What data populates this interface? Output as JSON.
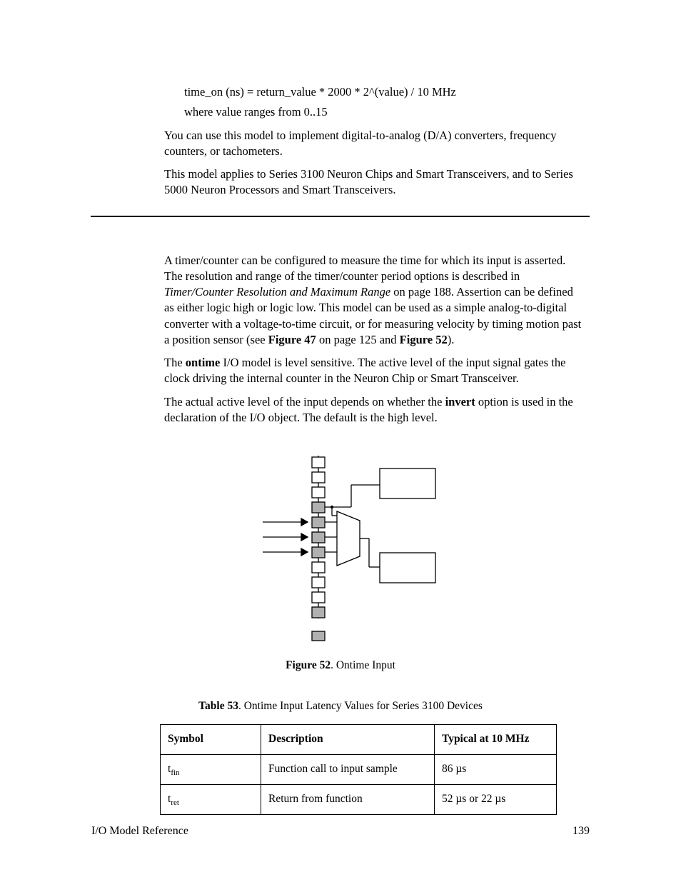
{
  "top": {
    "formula": "time_on (ns) = return_value * 2000 * 2^(value) / 10 MHz",
    "range": "where value ranges from 0..15",
    "p1": "You can use this model to implement digital-to-analog (D/A) converters, frequency counters, or tachometers.",
    "p2": "This model applies to Series 3100 Neuron Chips and Smart Transceivers, and to Series 5000 Neuron Processors and Smart Transceivers."
  },
  "mid": {
    "p1a": "A timer/counter can be configured to measure the time for which its input is asserted.  The resolution and range of the timer/counter period options is described in ",
    "p1_em": "Timer/Counter Resolution and Maximum Range",
    "p1b": " on page 188.  Assertion can be defined as either logic high or logic low.  This model can be used as a simple analog-to-digital converter with a voltage-to-time circuit, or for measuring velocity by timing motion past a position sensor (see ",
    "p1_bold1": "Figure 47",
    "p1c": " on page 125 and ",
    "p1_bold2": "Figure 52",
    "p1d": ").",
    "p2a": "The ",
    "p2_bold": "ontime",
    "p2b": " I/O model is level sensitive.  The active level of the input signal gates the clock driving the internal counter in the Neuron Chip or Smart Transceiver.",
    "p3a": "The actual active level of the input depends on whether the ",
    "p3_bold": "invert",
    "p3b": " option is used in the declaration of the I/O object.  The default is the high level."
  },
  "figure": {
    "label": "Figure 52",
    "caption": ". Ontime Input"
  },
  "table": {
    "label": "Table 53",
    "caption": ". Ontime Input Latency Values for Series 3100 Devices",
    "head": {
      "c1": "Symbol",
      "c2": "Description",
      "c3": "Typical at 10 MHz"
    },
    "rows": [
      {
        "sym_base": "t",
        "sym_sub": "fin",
        "desc": "Function call to input sample",
        "typ": "86 µs"
      },
      {
        "sym_base": "t",
        "sym_sub": "ret",
        "desc": "Return from function",
        "typ": "52 µs or 22 µs"
      }
    ]
  },
  "footer": {
    "left": "I/O Model Reference",
    "right": "139"
  }
}
